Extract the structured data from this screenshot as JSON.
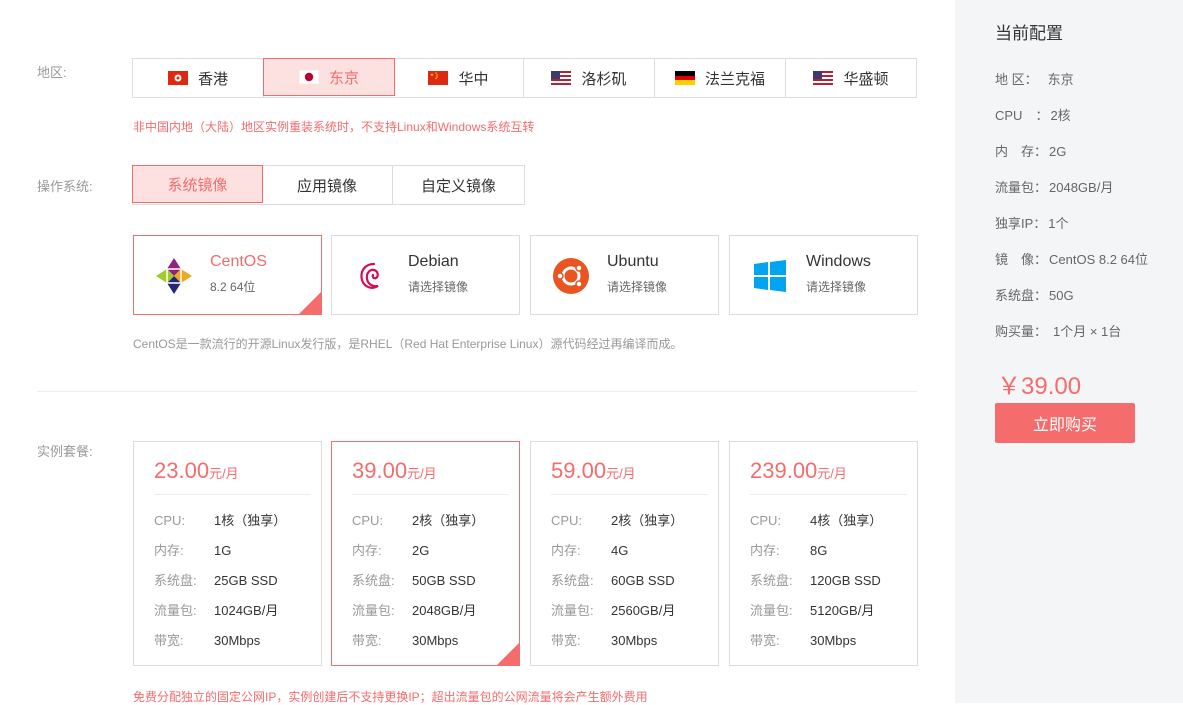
{
  "region": {
    "label": "地区:",
    "options": [
      "香港",
      "东京",
      "华中",
      "洛杉矶",
      "法兰克福",
      "华盛顿"
    ],
    "selected_index": 1,
    "note": "非中国内地（大陆）地区实例重装系统时，不支持Linux和Windows系统互转"
  },
  "os": {
    "label": "操作系统:",
    "tabs": [
      "系统镜像",
      "应用镜像",
      "自定义镜像"
    ],
    "selected_tab": 0,
    "cards": [
      {
        "name": "CentOS",
        "sub": "8.2 64位"
      },
      {
        "name": "Debian",
        "sub": "请选择镜像"
      },
      {
        "name": "Ubuntu",
        "sub": "请选择镜像"
      },
      {
        "name": "Windows",
        "sub": "请选择镜像"
      }
    ],
    "selected_card": 0,
    "description": "CentOS是一款流行的开源Linux发行版，是RHEL（Red Hat Enterprise Linux）源代码经过再编译而成。"
  },
  "plans": {
    "label": "实例套餐:",
    "unit": "元/月",
    "keys": {
      "cpu": "CPU:",
      "mem": "内存:",
      "disk": "系统盘:",
      "traffic": "流量包:",
      "bandwidth": "带宽:"
    },
    "items": [
      {
        "price": "23.00",
        "cpu": "1核（独享）",
        "mem": "1G",
        "disk": "25GB SSD",
        "traffic": "1024GB/月",
        "bandwidth": "30Mbps"
      },
      {
        "price": "39.00",
        "cpu": "2核（独享）",
        "mem": "2G",
        "disk": "50GB SSD",
        "traffic": "2048GB/月",
        "bandwidth": "30Mbps"
      },
      {
        "price": "59.00",
        "cpu": "2核（独享）",
        "mem": "4G",
        "disk": "60GB SSD",
        "traffic": "2560GB/月",
        "bandwidth": "30Mbps"
      },
      {
        "price": "239.00",
        "cpu": "4核（独享）",
        "mem": "8G",
        "disk": "120GB SSD",
        "traffic": "5120GB/月",
        "bandwidth": "30Mbps"
      }
    ],
    "selected_index": 1,
    "note": "免费分配独立的固定公网IP，实例创建后不支持更换IP；超出流量包的公网流量将会产生额外费用"
  },
  "summary": {
    "title": "当前配置",
    "rows": [
      {
        "k": "地 区：",
        "v": "东京"
      },
      {
        "k": "CPU　：",
        "v": "2核"
      },
      {
        "k": "内　存：",
        "v": "2G"
      },
      {
        "k": "流量包：",
        "v": "2048GB/月"
      },
      {
        "k": "独享IP：",
        "v": "1个"
      },
      {
        "k": "镜　像：",
        "v": "CentOS 8.2 64位"
      },
      {
        "k": "系统盘：",
        "v": "50G"
      },
      {
        "k": "购买量：",
        "v": "1个月 × 1台"
      }
    ],
    "total": "￥39.00",
    "buy_label": "立即购买"
  },
  "colors": {
    "accent": "#f56c6c",
    "accent_bg": "#fde0e0"
  }
}
